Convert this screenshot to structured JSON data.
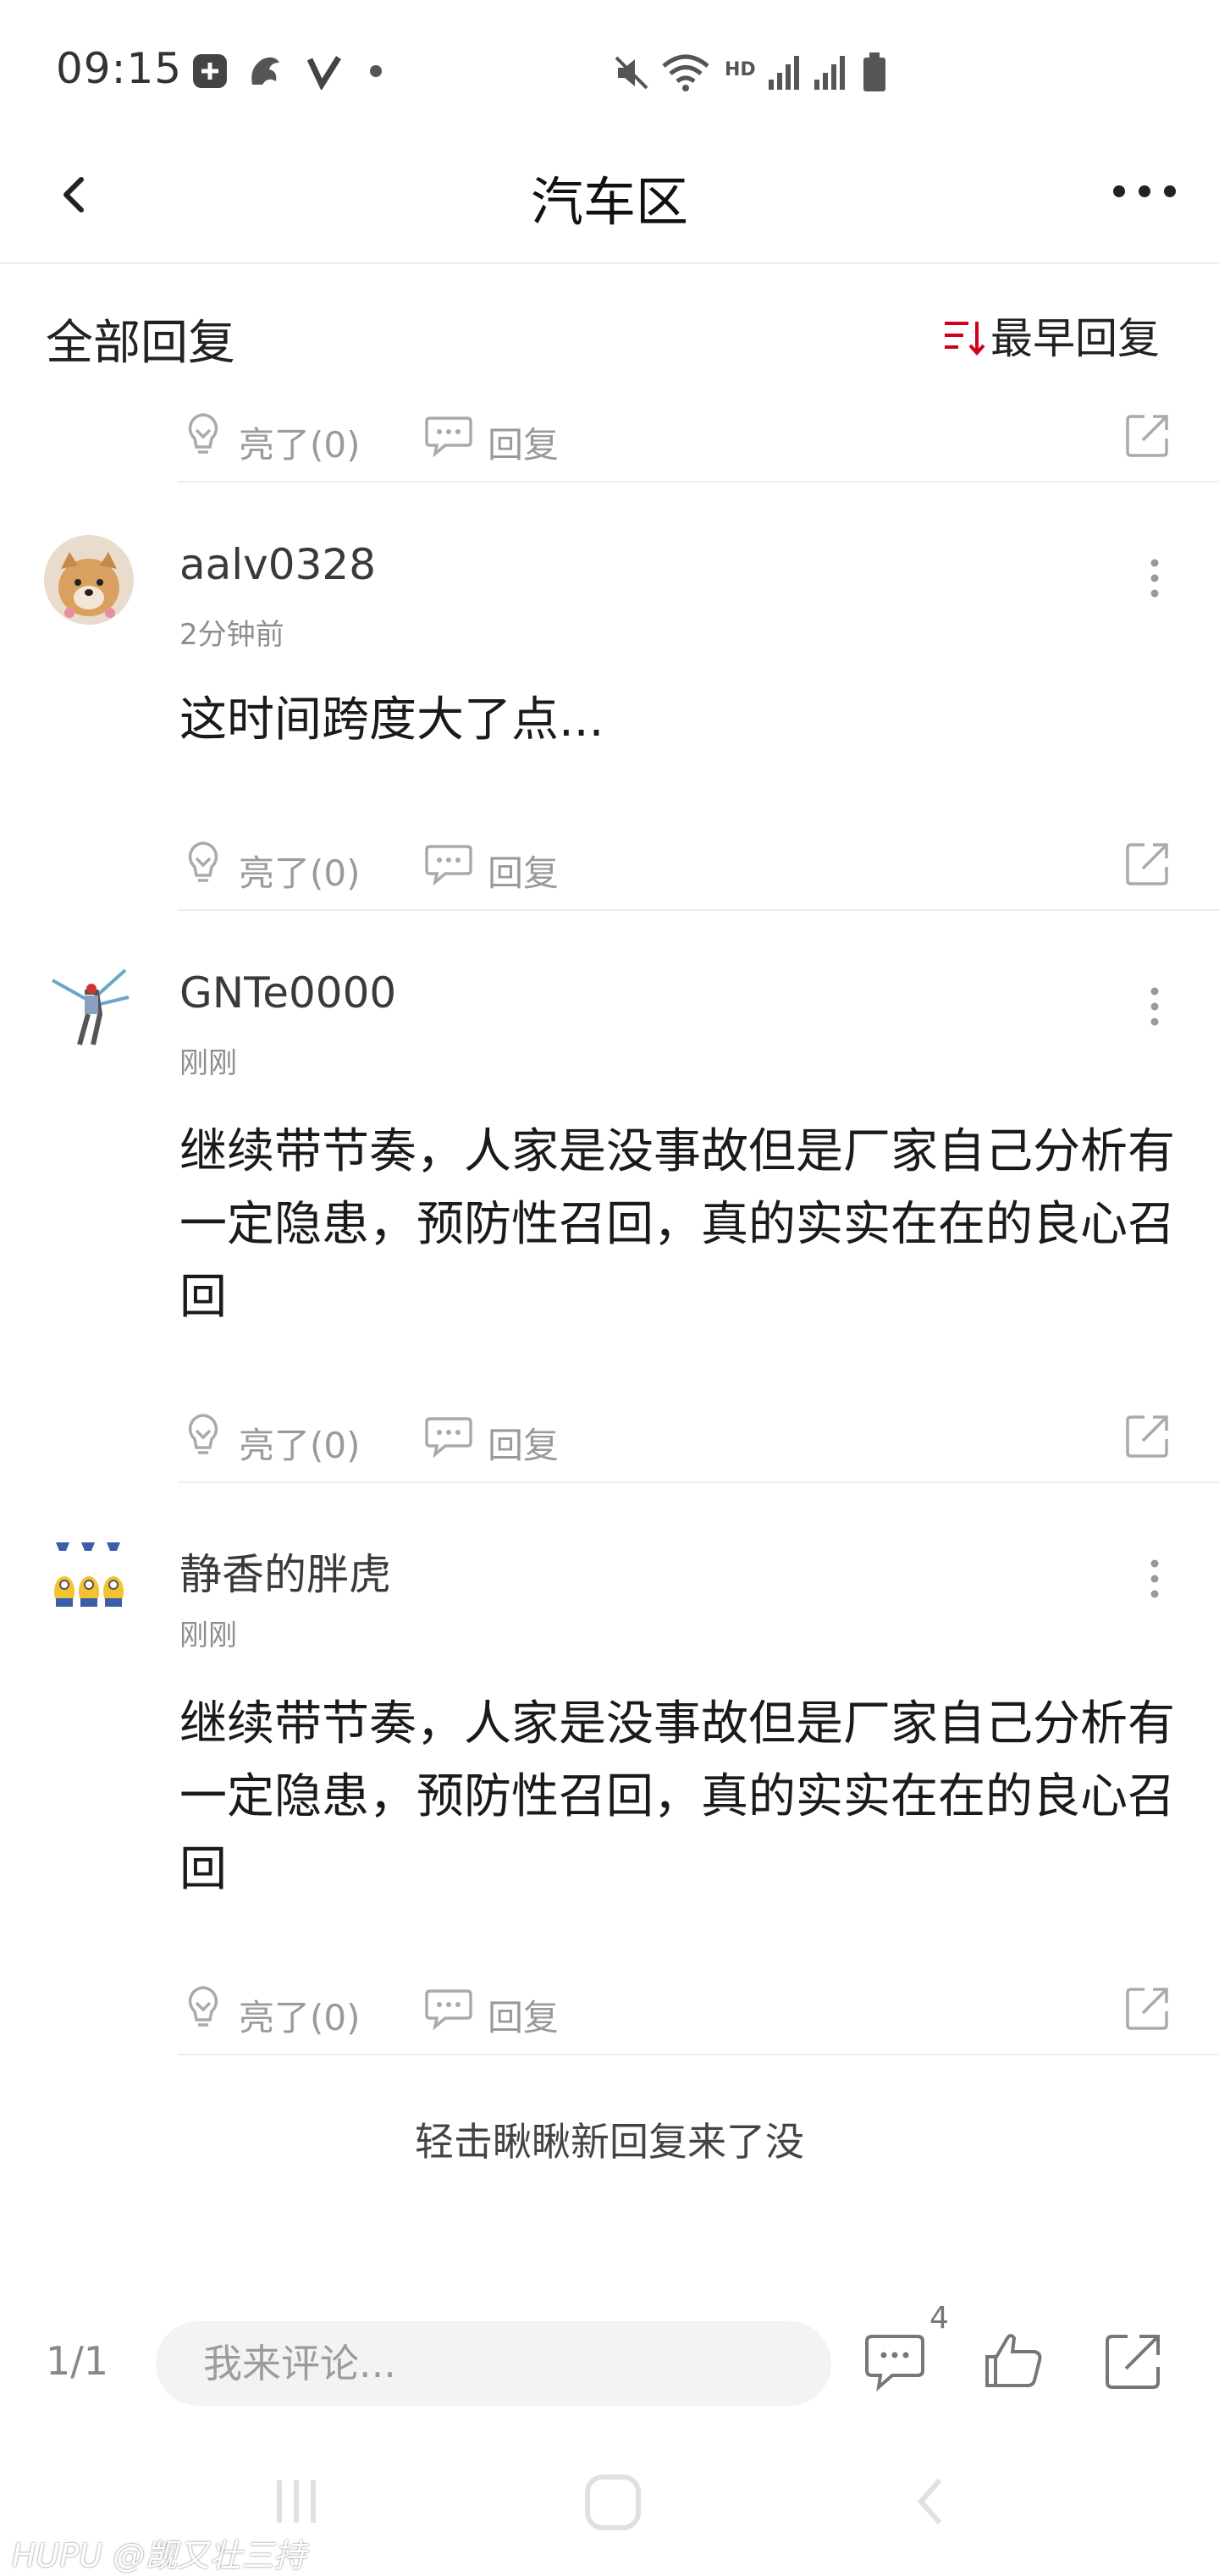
{
  "status_bar": {
    "time": "09:15",
    "icons": [
      "notification-icon",
      "dragon-app-icon",
      "v-app-icon",
      "dot-icon",
      "mute-icon",
      "wifi-icon",
      "hd-icon",
      "signal-icon",
      "signal-icon",
      "battery-icon"
    ],
    "hd_label": "HD"
  },
  "nav": {
    "back_icon": "chevron-left-icon",
    "title": "汽车区",
    "more_icon": "more-horizontal-icon"
  },
  "section": {
    "title": "全部回复",
    "sort_label": "最早回复",
    "sort_icon": "sort-icon"
  },
  "actions": {
    "like_label": "亮了(0)",
    "reply_label": "回复"
  },
  "comments": [
    {
      "username": "aalv0328",
      "timestamp": "2分钟前",
      "text": "这时间跨度大了点..."
    },
    {
      "username": "GNTe0000",
      "timestamp": "刚刚",
      "text": "继续带节奏，人家是没事故但是厂家自己分析有一定隐患，预防性召回，真的实实在在的良心召回"
    },
    {
      "username": "静香的胖虎",
      "timestamp": "刚刚",
      "text": "继续带节奏，人家是没事故但是厂家自己分析有一定隐患，预防性召回，真的实实在在的良心召回"
    }
  ],
  "load_more": "轻击瞅瞅新回复来了没",
  "bottom_bar": {
    "page_indicator": "1/1",
    "input_placeholder": "我来评论...",
    "comment_count": "4"
  },
  "watermark": "HUPU @觊又壮三持",
  "colors": {
    "accent_red": "#d0021b",
    "text_primary": "#1a1a1a",
    "text_secondary": "#8e8e8e",
    "divider": "#eeeeee"
  }
}
